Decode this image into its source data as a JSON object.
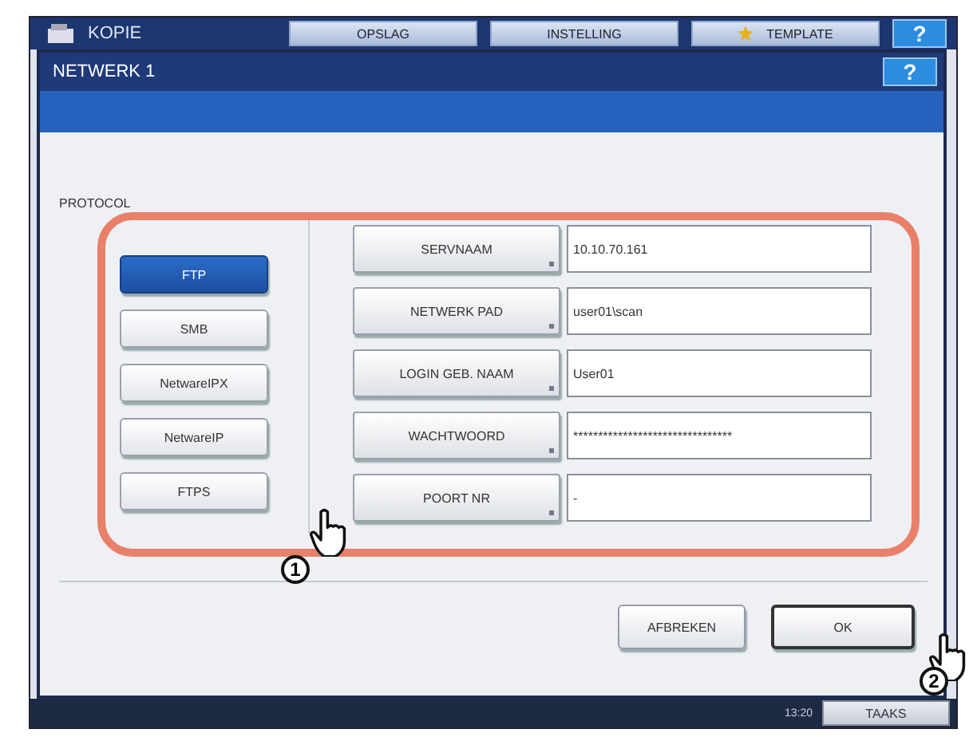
{
  "top_bar": {
    "title": "KOPIE",
    "tabs": [
      {
        "label": "OPSLAG",
        "icon": false
      },
      {
        "label": "INSTELLING",
        "icon": false
      },
      {
        "label": "TEMPLATE",
        "icon": true
      }
    ],
    "help": "?"
  },
  "dialog": {
    "title": "NETWERK 1",
    "help": "?",
    "protocol_label": "PROTOCOL",
    "protocols": [
      {
        "label": "FTP",
        "selected": true
      },
      {
        "label": "SMB",
        "selected": false
      },
      {
        "label": "NetwareIPX",
        "selected": false
      },
      {
        "label": "NetwareIP",
        "selected": false
      },
      {
        "label": "FTPS",
        "selected": false
      }
    ],
    "fields": [
      {
        "label": "SERVNAAM",
        "value": "10.10.70.161"
      },
      {
        "label": "NETWERK PAD",
        "value": "user01\\scan"
      },
      {
        "label": "LOGIN GEB. NAAM",
        "value": "User01"
      },
      {
        "label": "WACHTWOORD",
        "value": "********************************"
      },
      {
        "label": "POORT NR",
        "value": "-"
      }
    ],
    "buttons": [
      {
        "label": "AFBREKEN",
        "default": false
      },
      {
        "label": "OK",
        "default": true
      }
    ]
  },
  "status_bar": {
    "time": "13:20",
    "button": "TAAKS"
  },
  "callouts": [
    {
      "number": "1"
    },
    {
      "number": "2"
    }
  ]
}
